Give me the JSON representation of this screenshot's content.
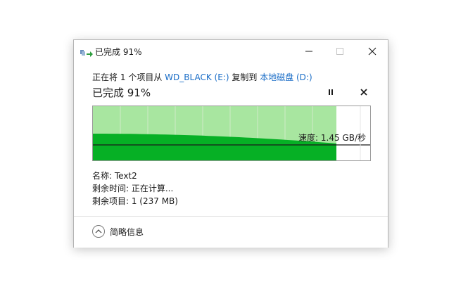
{
  "window": {
    "title": "已完成 91%",
    "icon": "file-copy-icon"
  },
  "transfer": {
    "prefix": "正在将",
    "count": "1",
    "unit_from": "个项目从",
    "source": "WD_BLACK (E:)",
    "action": "复制到",
    "destination": "本地磁盘 (D:)"
  },
  "status": {
    "heading": "已完成 91%",
    "percent_complete": 91
  },
  "graph": {
    "speed_label": "速度: 1.45 GB/秒",
    "progress_fraction": 0.91,
    "colors": {
      "background_band": "#a8e6a0",
      "speed_area": "#06b025",
      "speed_line": "#1a1a1a",
      "gridline": "#cfe9c9"
    }
  },
  "details": {
    "name": "名称: Text2",
    "time_remaining": "剩余时间: 正在计算...",
    "items_remaining": "剩余项目: 1 (237 MB)"
  },
  "footer": {
    "less_info_label": "简略信息"
  },
  "controls": {
    "pause_icon": "pause-icon",
    "cancel_icon": "close-icon"
  }
}
